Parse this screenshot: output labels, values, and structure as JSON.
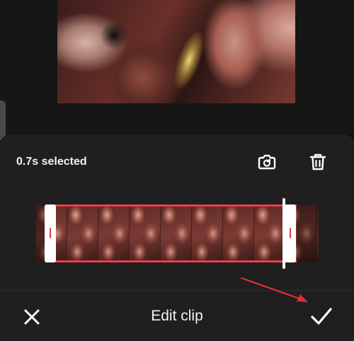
{
  "panel": {
    "selection_text": "0.7s selected"
  },
  "timeline": {
    "thumbnail_count": 9
  },
  "bottom_bar": {
    "title": "Edit clip"
  },
  "icons": {
    "replace": "replace-clip-icon",
    "delete": "trash-icon",
    "close": "close-icon",
    "confirm": "checkmark-icon"
  },
  "colors": {
    "background": "#131313",
    "panel": "#1f1f1f",
    "accent": "#e83e4c",
    "text": "#f2f2f2",
    "annotation": "#e0302f"
  }
}
